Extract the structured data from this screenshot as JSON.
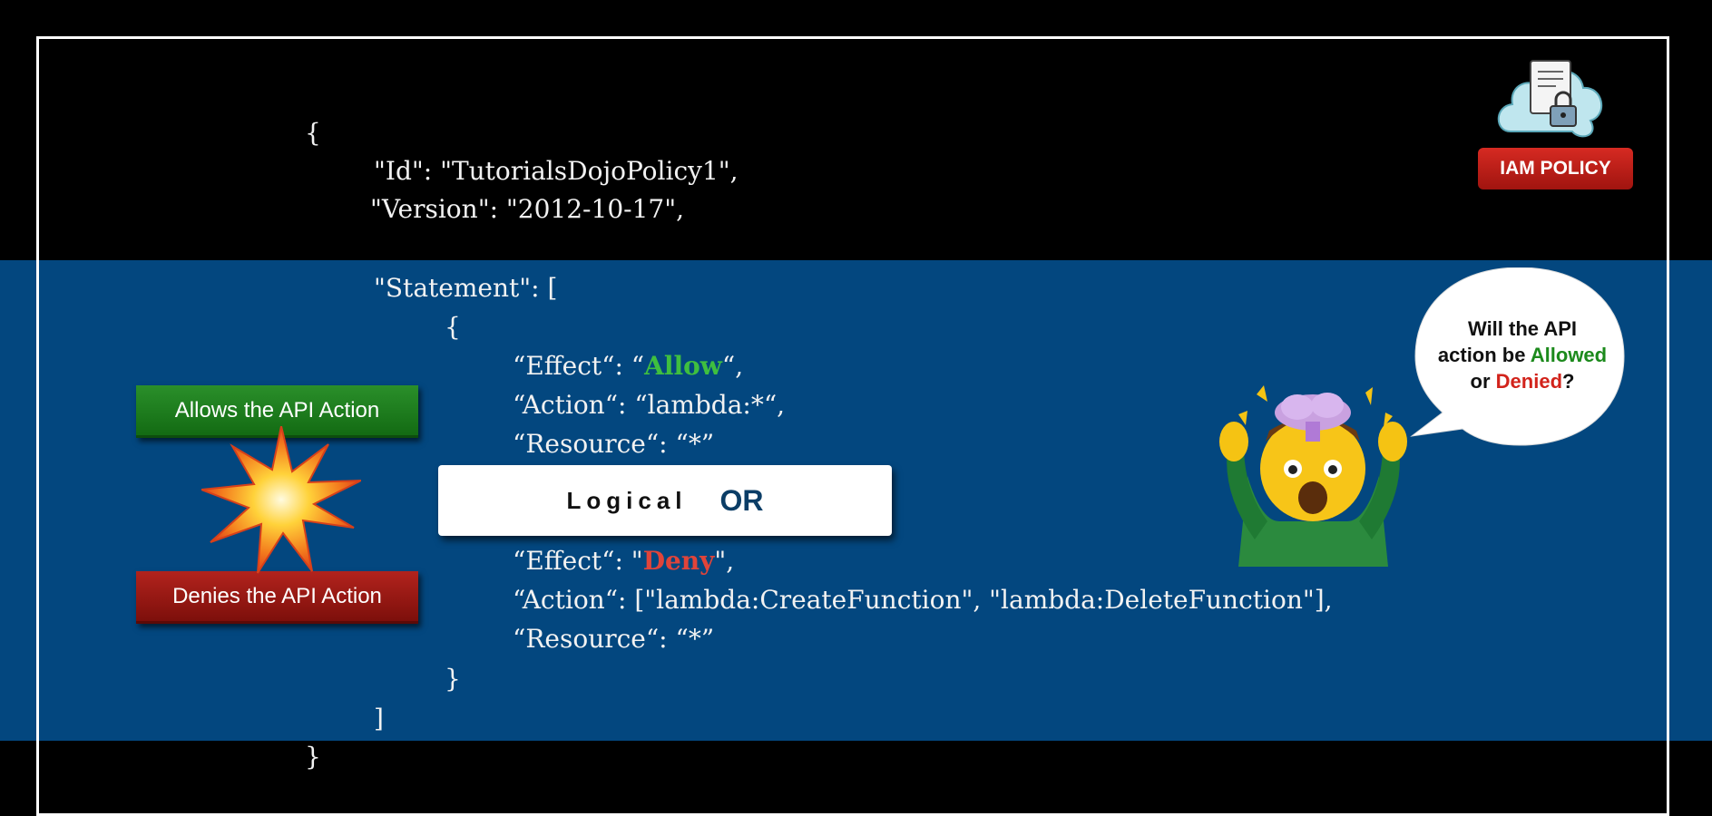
{
  "code": {
    "open_brace": "{",
    "id_line": "\"Id\": \"TutorialsDojoPolicy1\",",
    "version_line": "\"Version\": \"2012-10-17\",",
    "statement_line": "\"Statement\": [",
    "stmt1_open": "{",
    "allow_effect_prefix": "“Effect“: “",
    "allow_effect_value": "Allow",
    "allow_effect_suffix": "“,",
    "allow_action_line": "“Action“: “lambda:*“,",
    "allow_resource_line": "“Resource“: “*”",
    "deny_effect_prefix": "“Effect“: \"",
    "deny_effect_value": "Deny",
    "deny_effect_suffix": "\",",
    "deny_action_line": "“Action“: [\"lambda:CreateFunction\", \"lambda:DeleteFunction\"],",
    "deny_resource_line": "“Resource“: “*”",
    "stmt2_close": "}",
    "array_close": "]",
    "close_brace": "}"
  },
  "or_box": {
    "logical": "Logical",
    "or": "OR"
  },
  "labels": {
    "allows": "Allows the API Action",
    "denies": "Denies the API Action"
  },
  "badge": {
    "text": "IAM POLICY"
  },
  "bubble": {
    "line1": "Will the API",
    "line2_prefix": "action be ",
    "line2_allowed": "Allowed",
    "line3_prefix": "or ",
    "line3_denied": "Denied",
    "line3_suffix": "?"
  },
  "colors": {
    "background": "#000000",
    "band": "#03477f",
    "allow": "#3fbf3f",
    "deny": "#e0443a"
  },
  "icons": [
    "cloud-document-lock-icon",
    "explosion-icon",
    "mind-blown-person-icon"
  ]
}
